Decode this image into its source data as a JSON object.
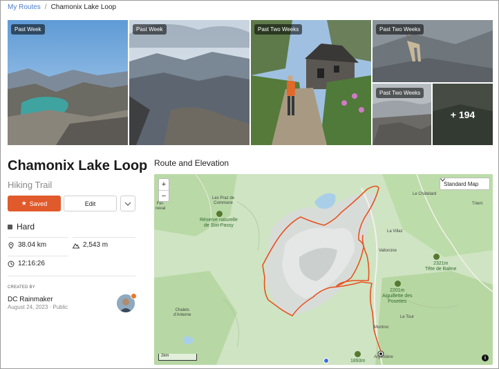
{
  "breadcrumb": {
    "parent": "My Routes",
    "current": "Chamonix Lake Loop"
  },
  "photos": [
    {
      "badge": "Past Week"
    },
    {
      "badge": "Past Week"
    },
    {
      "badge": "Past Two Weeks"
    },
    {
      "badge": "Past Two Weeks"
    },
    {
      "badge": "Past Two Weeks"
    },
    {
      "badge": "",
      "more": "+ 194"
    }
  ],
  "trail": {
    "title": "Chamonix Lake Loop",
    "type": "Hiking Trail",
    "difficulty": "Hard"
  },
  "actions": {
    "saved": "Saved",
    "edit": "Edit"
  },
  "stats": {
    "distance": "38.04 km",
    "elevation": "2,543 m",
    "duration": "12:16:26"
  },
  "creator": {
    "label": "CREATED BY",
    "name": "DC Rainmaker",
    "meta": "August 24, 2023 · Public"
  },
  "map": {
    "section_title": "Route and Elevation",
    "map_type": "Standard Map",
    "scale": "2km",
    "labels": {
      "fer": "Fer-\nneval",
      "praz": "Les Praz de\nCommune",
      "reserve": "Réserve naturelle\nde Sixt-Passy",
      "chatelard": "Le Châtelard",
      "trient": "Trient",
      "villaz": "La Villaz",
      "vallorcine": "Vallorcine",
      "balme_peak": "2321m\nTête de Balme",
      "posettes": "2201m\nAiguillette des\nPosettes",
      "tour": "Le Tour",
      "montroc": "Montroc",
      "chalets": "Chalets\nd'Anterne",
      "m1893": "1893m",
      "argentiere": "Argentière"
    }
  },
  "colors": {
    "accent": "#e05a2b",
    "route": "#e8521f",
    "link": "#4a7cc8"
  },
  "icons": [
    "star-icon",
    "chevron-down-icon",
    "location-pin-icon",
    "mountain-icon",
    "clock-icon",
    "plus-icon",
    "minus-icon",
    "info-icon"
  ]
}
